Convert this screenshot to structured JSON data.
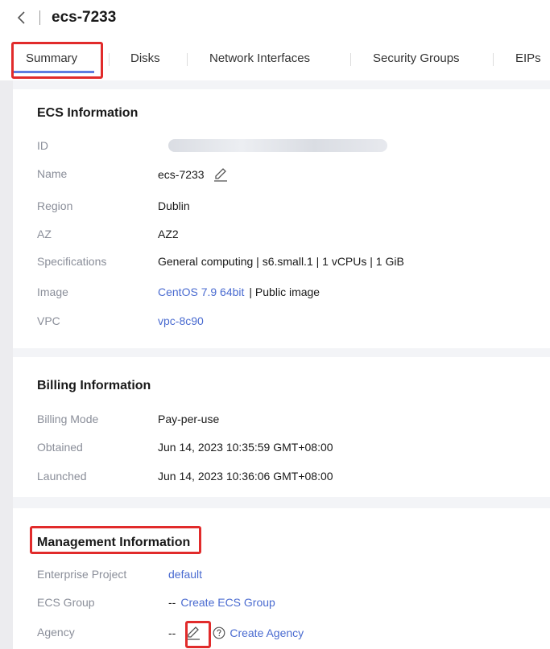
{
  "header": {
    "back_icon": "chevron-left-icon",
    "title": "ecs-7233"
  },
  "tabs": [
    {
      "label": "Summary",
      "active": true
    },
    {
      "label": "Disks"
    },
    {
      "label": "Network Interfaces"
    },
    {
      "label": "Security Groups"
    },
    {
      "label": "EIPs"
    }
  ],
  "ecs_info": {
    "title": "ECS Information",
    "id_label": "ID",
    "name_label": "Name",
    "name_value": "ecs-7233",
    "region_label": "Region",
    "region_value": "Dublin",
    "az_label": "AZ",
    "az_value": "AZ2",
    "spec_label": "Specifications",
    "spec_value": "General computing | s6.small.1 | 1 vCPUs | 1 GiB",
    "image_label": "Image",
    "image_link": "CentOS 7.9 64bit",
    "image_suffix": "| Public image",
    "vpc_label": "VPC",
    "vpc_value": "vpc-8c90"
  },
  "billing_info": {
    "title": "Billing Information",
    "mode_label": "Billing Mode",
    "mode_value": "Pay-per-use",
    "obtained_label": "Obtained",
    "obtained_value": "Jun 14, 2023 10:35:59 GMT+08:00",
    "launched_label": "Launched",
    "launched_value": "Jun 14, 2023 10:36:06 GMT+08:00"
  },
  "management_info": {
    "title": "Management Information",
    "project_label": "Enterprise Project",
    "project_value": "default",
    "group_label": "ECS Group",
    "group_value": "--",
    "group_link": "Create ECS Group",
    "agency_label": "Agency",
    "agency_value": "--",
    "agency_link": "Create Agency"
  },
  "colors": {
    "accent": "#5e7ce0",
    "link": "#4a6bd0",
    "highlight": "#e12b2b"
  }
}
